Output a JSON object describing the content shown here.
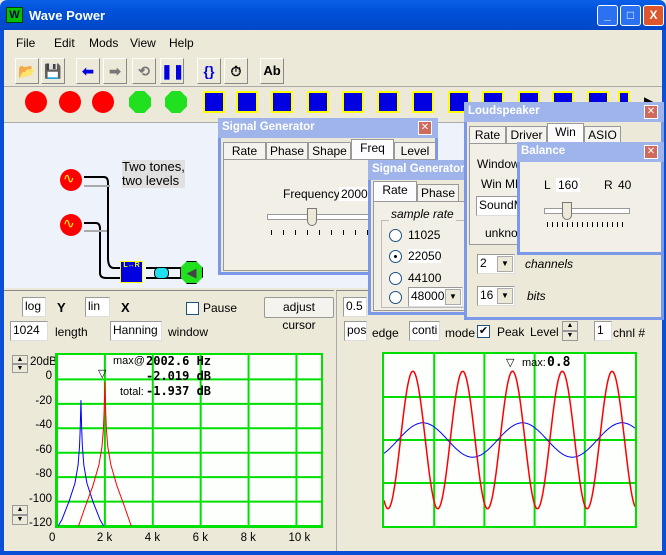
{
  "window": {
    "title": "Wave Power",
    "minimize": "_",
    "maximize": "□",
    "close": "X"
  },
  "menu": [
    "File",
    "Edit",
    "Mods",
    "View",
    "Help"
  ],
  "toolbar": [
    {
      "icon": "open-folder-icon",
      "glyph": "📂"
    },
    {
      "icon": "save-disk-icon",
      "glyph": "💾"
    },
    {
      "icon": "arrow-left-icon",
      "glyph": "⬅"
    },
    {
      "icon": "arrow-right-icon",
      "glyph": "➡"
    },
    {
      "icon": "loop-icon",
      "glyph": "⟲"
    },
    {
      "icon": "pause-icon",
      "glyph": "❚❚"
    },
    {
      "icon": "braces-icon",
      "glyph": "{}"
    },
    {
      "icon": "stopwatch-icon",
      "glyph": "⏱"
    },
    {
      "icon": "text-icon",
      "glyph": "Ab"
    }
  ],
  "modules": [
    "microphone",
    "wave-file-in",
    "sine-generator",
    "speaker-off",
    "file-out",
    "balance-in",
    "histogram",
    "filter-low",
    "filter-band",
    "filter-high",
    "mixer",
    "delay",
    "echo",
    "stereo",
    "scope",
    "meter",
    "display",
    "more"
  ],
  "canvas": {
    "note": "Two tones,\ntwo levels",
    "balance_label": "L↔R"
  },
  "sg1": {
    "title": "Signal Generator",
    "tabs": [
      "Rate",
      "Phase",
      "Shape",
      "Freq",
      "Level"
    ],
    "active": "Freq",
    "freq_label": "Frequency",
    "freq_value": "2000",
    "slider_fraction": 0.2
  },
  "sg2": {
    "title": "Signal Generator",
    "tabs": [
      "Rate",
      "Phase"
    ],
    "group": "sample rate",
    "rates": [
      "11025",
      "22050",
      "44100"
    ],
    "selected": "22050",
    "combo": "48000"
  },
  "speaker": {
    "title": "Loudspeaker",
    "tabs": [
      "Rate",
      "Driver",
      "Win",
      "ASIO"
    ],
    "active": "Win",
    "windows": "Windows",
    "winmm": "Win MM",
    "device": "SoundMa",
    "unknown": "unknow",
    "channels": "2",
    "channels_label": "channels",
    "bits": "16",
    "bits_label": "bits"
  },
  "balance": {
    "title": "Balance",
    "l_label": "L",
    "l_value": "160",
    "r_label": "R",
    "r_value": "40",
    "slider_fraction": 0.2
  },
  "spectrum": {
    "yscale": "log",
    "y_label": "Y",
    "xscale": "lin",
    "x_label": "X",
    "pause": "Pause",
    "pause_checked": false,
    "adjust": "adjust cursor",
    "length": "1024",
    "length_label": "length",
    "window": "Hanning",
    "window_label": "window",
    "max_prefix": "max@",
    "max_freq": "2002.6 Hz",
    "max_db": "-2.019 dB",
    "total_prefix": "total:",
    "total_db": "-1.937 dB",
    "top_label": "20dB"
  },
  "scope": {
    "trigger": "0.5",
    "edge": "pos",
    "edge_label": "edge",
    "mode": "conti",
    "mode_label": "mode",
    "peak_label": "Peak",
    "peak_checked": true,
    "level_label": "Level",
    "channel": "1",
    "channel_label": "chnl #",
    "max_prefix": "max:",
    "max_value": "0.8"
  },
  "colors": {
    "grid": "#00e000",
    "series1": "#0000ff",
    "series2": "#ff0000"
  },
  "chart_data": [
    {
      "type": "line",
      "xlabel": "",
      "ylabel": "",
      "xlim": [
        0,
        11025
      ],
      "ylim": [
        -120,
        20
      ],
      "xticks": [
        0,
        2000,
        4000,
        6000,
        8000,
        10000
      ],
      "xtick_labels": [
        "0",
        "2 k",
        "4 k",
        "6 k",
        "8 k",
        "10 k"
      ],
      "yticks": [
        0,
        -20,
        -40,
        -60,
        -80,
        -100,
        -120
      ],
      "ytick_labels": [
        "0",
        "-20",
        "-40",
        "-60",
        "-80",
        "-100",
        "-120"
      ],
      "grid": true,
      "series": [
        {
          "color": "#0000ff",
          "points": [
            [
              50,
              -120
            ],
            [
              200,
              -115
            ],
            [
              500,
              -100
            ],
            [
              750,
              -85
            ],
            [
              880,
              -70
            ],
            [
              940,
              -55
            ],
            [
              970,
              -40
            ],
            [
              1000,
              -17
            ],
            [
              1030,
              -40
            ],
            [
              1060,
              -55
            ],
            [
              1120,
              -70
            ],
            [
              1250,
              -85
            ],
            [
              1500,
              -100
            ],
            [
              1800,
              -115
            ],
            [
              1950,
              -120
            ]
          ]
        },
        {
          "color": "#ff0000",
          "points": [
            [
              900,
              -120
            ],
            [
              1200,
              -103
            ],
            [
              1500,
              -87
            ],
            [
              1750,
              -70
            ],
            [
              1880,
              -55
            ],
            [
              1940,
              -40
            ],
            [
              1970,
              -25
            ],
            [
              2002.6,
              -2
            ],
            [
              2030,
              -25
            ],
            [
              2060,
              -40
            ],
            [
              2120,
              -55
            ],
            [
              2250,
              -70
            ],
            [
              2500,
              -87
            ],
            [
              2800,
              -103
            ],
            [
              3100,
              -120
            ]
          ]
        }
      ]
    },
    {
      "type": "line",
      "xlabel": "",
      "ylabel": "",
      "xlim": [
        0,
        2.52
      ],
      "ylim": [
        -1,
        1
      ],
      "grid": true,
      "grid_cols": 5,
      "grid_rows": 4,
      "series": [
        {
          "color": "#0000ff",
          "frequency_khz": 1,
          "amplitude": 0.2,
          "peak_ms": 0.39
        },
        {
          "color": "#ff0000",
          "frequency_khz": 2,
          "amplitude": 0.8,
          "peak_ms": 0.29
        }
      ]
    }
  ]
}
